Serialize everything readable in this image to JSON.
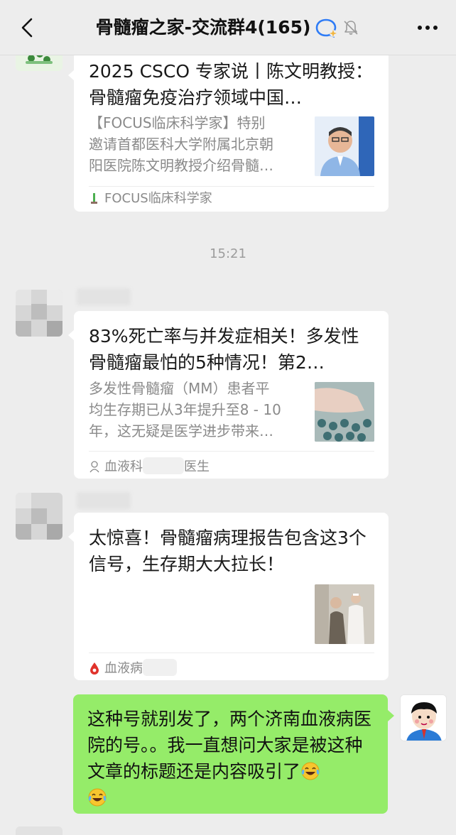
{
  "header": {
    "title": "骨髓瘤之家-交流群4(165)",
    "icons": [
      "back-chevron-icon",
      "ai-assistant-icon",
      "mute-bell-icon",
      "more-dots-icon"
    ]
  },
  "messages": {
    "card1": {
      "title": "2025 CSCO 专家说丨陈文明教授：骨髓瘤免疫治疗领域中国…",
      "desc_lines": [
        "【FOCUS临床科学家】特别",
        "邀请首都医科大学附属北京朝",
        "阳医院陈文明教授介绍骨髓…"
      ],
      "source": "FOCUS临床科学家"
    },
    "timestamp": "15:21",
    "card2": {
      "title": "83%死亡率与并发症相关！多发性骨髓瘤最怕的5种情况！第2…",
      "desc_lines": [
        "多发性骨髓瘤（MM）患者平",
        "均生存期已从3年提升至8 - 10",
        "年，这无疑是医学进步带来…"
      ],
      "source": "血液科",
      "source_suffix": "医生"
    },
    "card3": {
      "title": "太惊喜！骨髓瘤病理报告包含这3个信号，生存期大大拉长！",
      "source": "血液病"
    },
    "my_message": {
      "text": "这种号就别发了，两个济南血液病医院的号。。我一直想问大家是被这种文章的标题还是内容吸引了",
      "emoji": "laughing-tears-emoji"
    }
  },
  "colors": {
    "background": "#ededed",
    "bubble_mine": "#95ec69",
    "card": "#ffffff",
    "secondary_text": "#8a8a8a"
  }
}
